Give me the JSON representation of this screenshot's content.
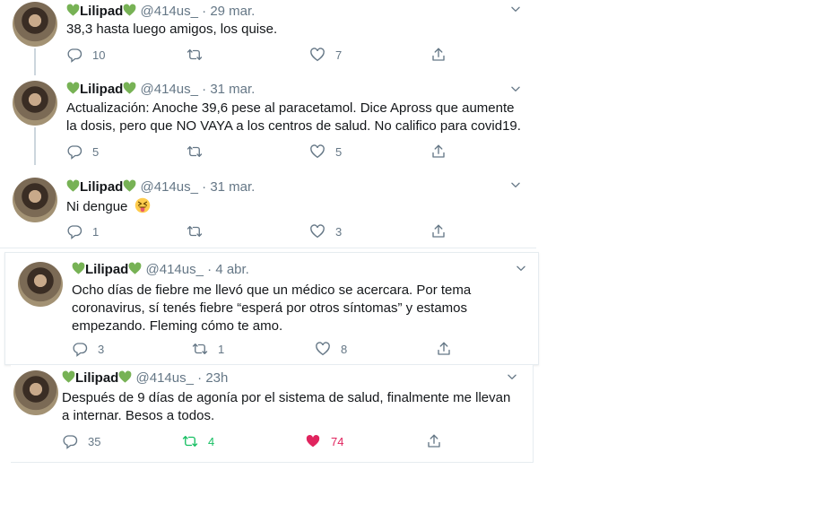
{
  "colors": {
    "text": "#14171a",
    "muted": "#657786",
    "retweet_active": "#17bf63",
    "like_active": "#e0245e",
    "heart_emoji": "#77b255"
  },
  "icons": {
    "reply": "reply-icon",
    "retweet": "retweet-icon",
    "like": "like-icon",
    "share": "share-icon",
    "more": "chevron-down-icon",
    "emoji_heart": "green-heart-icon",
    "emoji_face": "squinting-face-tongue-icon"
  },
  "tweets": [
    {
      "name": "Lilipad",
      "handle": "@414us_",
      "dot": "·",
      "date": "29 mar.",
      "text": "38,3 hasta luego amigos, los quise.",
      "replies": "10",
      "retweets": "",
      "likes": "7"
    },
    {
      "name": "Lilipad",
      "handle": "@414us_",
      "dot": "·",
      "date": "31 mar.",
      "text": "Actualización: Anoche 39,6 pese al paracetamol. Dice Apross que aumente la dosis, pero que NO VAYA a los centros de salud. No califico para covid19.",
      "replies": "5",
      "retweets": "",
      "likes": "5"
    },
    {
      "name": "Lilipad",
      "handle": "@414us_",
      "dot": "·",
      "date": "31 mar.",
      "text": "Ni dengue",
      "replies": "1",
      "retweets": "",
      "likes": "3"
    },
    {
      "name": "Lilipad",
      "handle": "@414us_",
      "dot": "·",
      "date": "4 abr.",
      "text": "Ocho días de fiebre me llevó que un médico se acercara. Por tema coronavirus, sí tenés fiebre “esperá por otros síntomas” y estamos empezando. Fleming cómo te amo.",
      "replies": "3",
      "retweets": "1",
      "likes": "8"
    },
    {
      "name": "Lilipad",
      "handle": "@414us_",
      "dot": "·",
      "date": "23h",
      "text": "Después de 9 días de agonía por el sistema de salud, finalmente me llevan a internar. Besos a todos.",
      "replies": "35",
      "retweets": "4",
      "likes": "74"
    }
  ]
}
